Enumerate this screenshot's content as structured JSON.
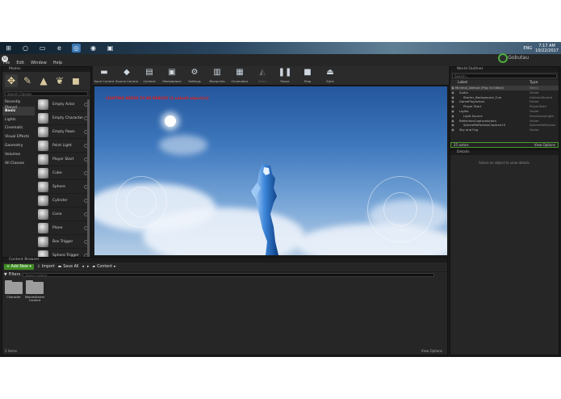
{
  "taskbar": {
    "icons": [
      "windows-icon",
      "search-icon",
      "task-view-icon",
      "edge-icon",
      "unreal-icon",
      "chrome-icon",
      "app-icon"
    ],
    "time": "7:17 AM",
    "date": "10/22/2017",
    "lang": "ENG"
  },
  "menu": {
    "items": [
      "File",
      "Edit",
      "Window",
      "Help"
    ],
    "project": "Gobutau"
  },
  "modes": {
    "title": "Modes",
    "search_placeholder": "Search Classes",
    "categories": [
      "Recently Placed",
      "Basic",
      "Lights",
      "Cinematic",
      "Visual Effects",
      "Geometry",
      "Volumes",
      "All Classes"
    ],
    "selected": 1,
    "items": [
      "Empty Actor",
      "Empty Character",
      "Empty Pawn",
      "Point Light",
      "Player Start",
      "Cube",
      "Sphere",
      "Cylinder",
      "Cone",
      "Plane",
      "Box Trigger",
      "Sphere Trigger"
    ]
  },
  "toolbar": [
    {
      "label": "Save Current",
      "icon": "save-icon",
      "g": "▬"
    },
    {
      "label": "Source Control",
      "icon": "source-control-icon",
      "g": "◆"
    },
    {
      "label": "Content",
      "icon": "content-icon",
      "g": "▤"
    },
    {
      "label": "Marketplace",
      "icon": "marketplace-icon",
      "g": "▣"
    },
    {
      "label": "Settings",
      "icon": "settings-icon",
      "g": "⚙"
    },
    {
      "label": "Blueprints",
      "icon": "blueprints-icon",
      "g": "▥"
    },
    {
      "label": "Cinematics",
      "icon": "cinematics-icon",
      "g": "▦"
    },
    {
      "label": "Build",
      "icon": "build-icon",
      "g": "◭"
    },
    {
      "label": "Pause",
      "icon": "pause-icon",
      "g": "❚❚"
    },
    {
      "label": "Stop",
      "icon": "stop-icon",
      "g": "■"
    },
    {
      "label": "Eject",
      "icon": "eject-icon",
      "g": "⏏"
    }
  ],
  "viewport": {
    "warning": "LIGHTING NEEDS TO BE REBUILT (2 unbuilt object(s))"
  },
  "content_browser": {
    "tab": "Content Browser",
    "add_new": "Add New",
    "import": "Import",
    "save_all": "Save All",
    "path": "Content",
    "filters": "Filters",
    "search_placeholder": "Search Content",
    "folders": [
      "Character",
      "MobileStarter Content"
    ],
    "status": "2 items",
    "view_options": "View Options"
  },
  "world_outliner": {
    "title": "World Outliner",
    "search_placeholder": "Search...",
    "col_label": "Label",
    "col_type": "Type",
    "rows": [
      {
        "label": "Minimal_Default (Play In Editor)",
        "type": "World",
        "d": 0
      },
      {
        "label": "Audio",
        "type": "Folder",
        "d": 1
      },
      {
        "label": "Starter_Background_Cue",
        "type": "AmbientSound",
        "d": 2
      },
      {
        "label": "GamePlayActors",
        "type": "Folder",
        "d": 1
      },
      {
        "label": "Player Start",
        "type": "PlayerStart",
        "d": 2
      },
      {
        "label": "Lights",
        "type": "Folder",
        "d": 1
      },
      {
        "label": "Light Source",
        "type": "DirectionalLight",
        "d": 2
      },
      {
        "label": "ReflectionCaptureActors",
        "type": "Folder",
        "d": 1
      },
      {
        "label": "SphereReflectionCapture10",
        "type": "SphereReflection",
        "d": 2
      },
      {
        "label": "Sky and Fog",
        "type": "Folder",
        "d": 1
      }
    ],
    "count": "25 actors",
    "view_options": "View Options"
  },
  "details": {
    "title": "Details",
    "message": "Select an object to view details."
  }
}
